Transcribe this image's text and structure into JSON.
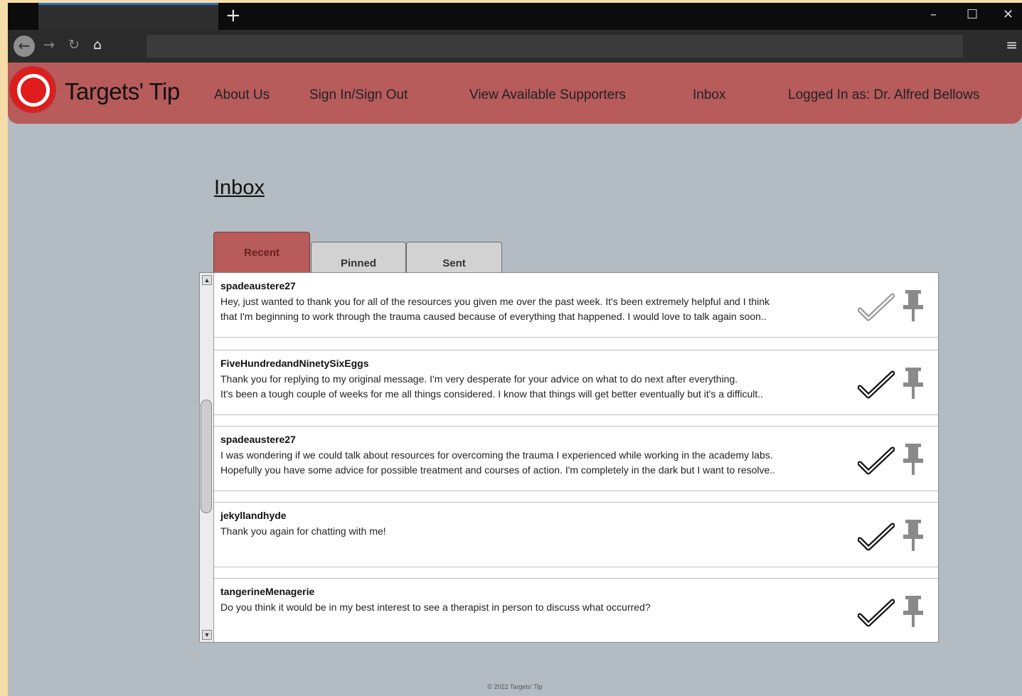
{
  "browser": {
    "new_tab_icon": "plus-icon",
    "window_controls": [
      "minimize-icon",
      "maximize-icon",
      "close-icon"
    ]
  },
  "header": {
    "brand": "Targets' Tip",
    "nav": {
      "about": "About Us",
      "sign_in": "Sign In/Sign Out",
      "supporters": "View Available Supporters",
      "inbox": "Inbox",
      "logged_in": "Logged In as: Dr. Alfred Bellows"
    },
    "accent_color": "#b75b5b"
  },
  "main": {
    "title": "Inbox",
    "tabs": [
      "Recent",
      "Pinned",
      "Sent"
    ],
    "active_tab": "Recent",
    "messages": [
      {
        "sender": "spadeaustere27",
        "preview": "Hey, just wanted to thank you for all of the resources you given me over the past week. It's been extremely helpful and I think\nthat I'm beginning to work through the trauma caused because of everything that happened. I would love to talk again soon..",
        "read": false
      },
      {
        "sender": "FiveHundredandNinetySixEggs",
        "preview": "Thank you for replying to my original message. I'm very desperate for your advice on what to do next after everything.\nIt's been a tough couple of weeks for me all things considered. I know that things will get better eventually but it's a difficult..",
        "read": true
      },
      {
        "sender": "spadeaustere27",
        "preview": "I was wondering if we could talk about resources for overcoming the trauma I experienced while working in the academy labs.\nHopefully you have some advice for possible treatment and courses of action. I'm completely in the dark but I want to resolve..",
        "read": true
      },
      {
        "sender": "jekyllandhyde",
        "preview": "Thank you again for chatting with me!",
        "read": true
      },
      {
        "sender": "tangerineMenagerie",
        "preview": "Do you think it would be in my best interest to see a therapist in person to discuss what occurred?",
        "read": true
      }
    ]
  },
  "footer": {
    "text": "© 2022 Targets' Tip"
  }
}
